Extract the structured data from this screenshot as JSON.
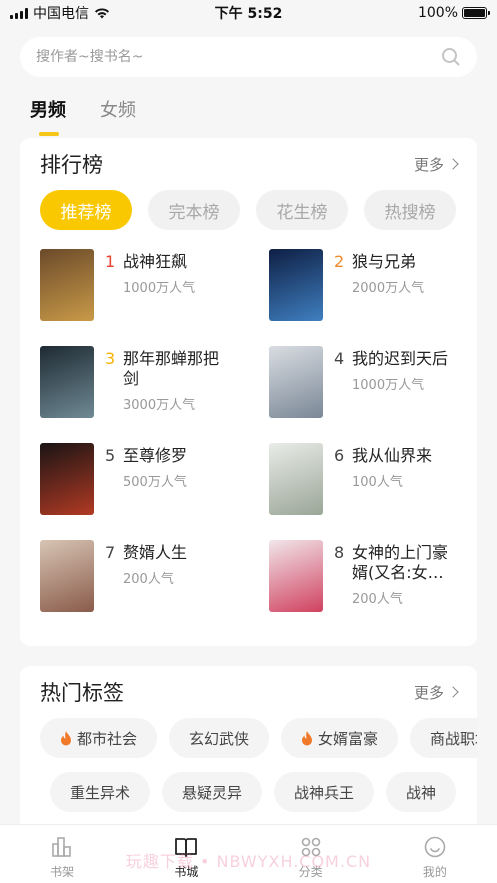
{
  "status_bar": {
    "carrier": "中国电信",
    "time": "下午 5:52",
    "battery": "100%"
  },
  "search": {
    "placeholder": "搜作者~搜书名~",
    "icon": "search-icon"
  },
  "gender_tabs": [
    {
      "label": "男频",
      "active": true
    },
    {
      "label": "女频",
      "active": false
    }
  ],
  "ranking": {
    "title": "排行榜",
    "more_label": "更多",
    "tabs": [
      {
        "label": "推荐榜",
        "active": true
      },
      {
        "label": "完本榜",
        "active": false
      },
      {
        "label": "花生榜",
        "active": false
      },
      {
        "label": "热搜榜",
        "active": false
      }
    ],
    "books": [
      {
        "rank": "1",
        "title": "战神狂飙",
        "popularity": "1000万人气",
        "cover_colors": [
          "#6b4a2a",
          "#c99a48"
        ]
      },
      {
        "rank": "2",
        "title": "狼与兄弟",
        "popularity": "2000万人气",
        "cover_colors": [
          "#0e1f44",
          "#3f7fc0"
        ]
      },
      {
        "rank": "3",
        "title": "那年那蝉那把剑",
        "popularity": "3000万人气",
        "cover_colors": [
          "#1e2a33",
          "#6f8a94"
        ]
      },
      {
        "rank": "4",
        "title": "我的迟到天后",
        "popularity": "1000万人气",
        "cover_colors": [
          "#d9dde2",
          "#7a8796"
        ]
      },
      {
        "rank": "5",
        "title": "至尊修罗",
        "popularity": "500万人气",
        "cover_colors": [
          "#1a1414",
          "#b23a24"
        ]
      },
      {
        "rank": "6",
        "title": "我从仙界来",
        "popularity": "100人气",
        "cover_colors": [
          "#e9ece8",
          "#9aa597"
        ]
      },
      {
        "rank": "7",
        "title": "赘婿人生",
        "popularity": "200人气",
        "cover_colors": [
          "#d7c4b4",
          "#8a5b4a"
        ]
      },
      {
        "rank": "8",
        "title": "女神的上门豪婿(又名:女神的超级赘婿)",
        "popularity": "200人气",
        "cover_colors": [
          "#f1e6ea",
          "#d0415f"
        ]
      }
    ]
  },
  "hot_tags": {
    "title": "热门标签",
    "more_label": "更多",
    "row1": [
      {
        "label": "都市社会",
        "hot": true
      },
      {
        "label": "玄幻武侠",
        "hot": false
      },
      {
        "label": "女婿富豪",
        "hot": true
      },
      {
        "label": "商战职场",
        "hot": false
      }
    ],
    "row2": [
      {
        "label": "重生异术",
        "hot": false
      },
      {
        "label": "悬疑灵异",
        "hot": false
      },
      {
        "label": "战神兵王",
        "hot": false
      },
      {
        "label": "战神",
        "hot": false
      }
    ]
  },
  "bottom_nav": [
    {
      "label": "书架",
      "icon": "bookshelf-icon",
      "active": false
    },
    {
      "label": "书城",
      "icon": "book-open-icon",
      "active": true
    },
    {
      "label": "分类",
      "icon": "grid-icon",
      "active": false
    },
    {
      "label": "我的",
      "icon": "smiley-icon",
      "active": false
    }
  ],
  "watermark": "玩趣下载 • NBWYXH.COM.CN",
  "colors": {
    "accent": "#f9c800",
    "rank1": "#e8432f",
    "rank2": "#f08a28",
    "rank3": "#f5b400",
    "flame": "#f07a2a"
  }
}
